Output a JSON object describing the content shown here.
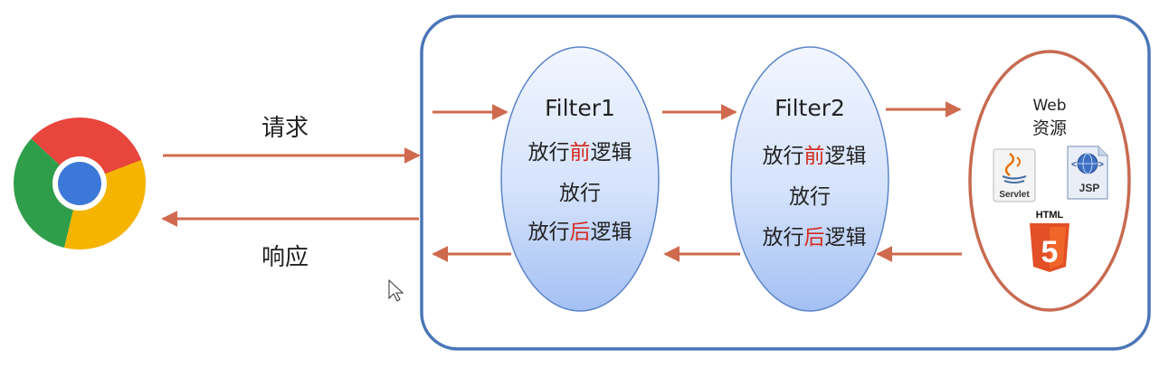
{
  "labels": {
    "request": "请求",
    "response": "响应"
  },
  "filters": [
    {
      "title": "Filter1",
      "lines": [
        {
          "pre": "放行",
          "highlight": "前",
          "post": "逻辑"
        },
        {
          "pre": "放行",
          "highlight": "",
          "post": ""
        },
        {
          "pre": "放行",
          "highlight": "后",
          "post": "逻辑"
        }
      ]
    },
    {
      "title": "Filter2",
      "lines": [
        {
          "pre": "放行",
          "highlight": "前",
          "post": "逻辑"
        },
        {
          "pre": "放行",
          "highlight": "",
          "post": ""
        },
        {
          "pre": "放行",
          "highlight": "后",
          "post": "逻辑"
        }
      ]
    }
  ],
  "resource": {
    "title_line1": "Web",
    "title_line2": "资源",
    "servlet_label": "Servlet",
    "jsp_label": "JSP",
    "html_label": "HTML",
    "html_number": "5"
  },
  "icons": {
    "browser": "chrome-browser-icon",
    "servlet": "java-servlet-icon",
    "jsp": "jsp-icon",
    "html5": "html5-icon",
    "cursor": "mouse-cursor-icon"
  },
  "colors": {
    "container_border": "#4a76b8",
    "arrow": "#cf6a4f",
    "ellipse_border": "#5b84c8",
    "ellipse_fill_top": "#eef3ff",
    "ellipse_fill_bottom": "#a9c4f5",
    "resource_border": "#c76a50",
    "highlight_text": "#d42a1e",
    "html5_orange": "#e34f26"
  }
}
